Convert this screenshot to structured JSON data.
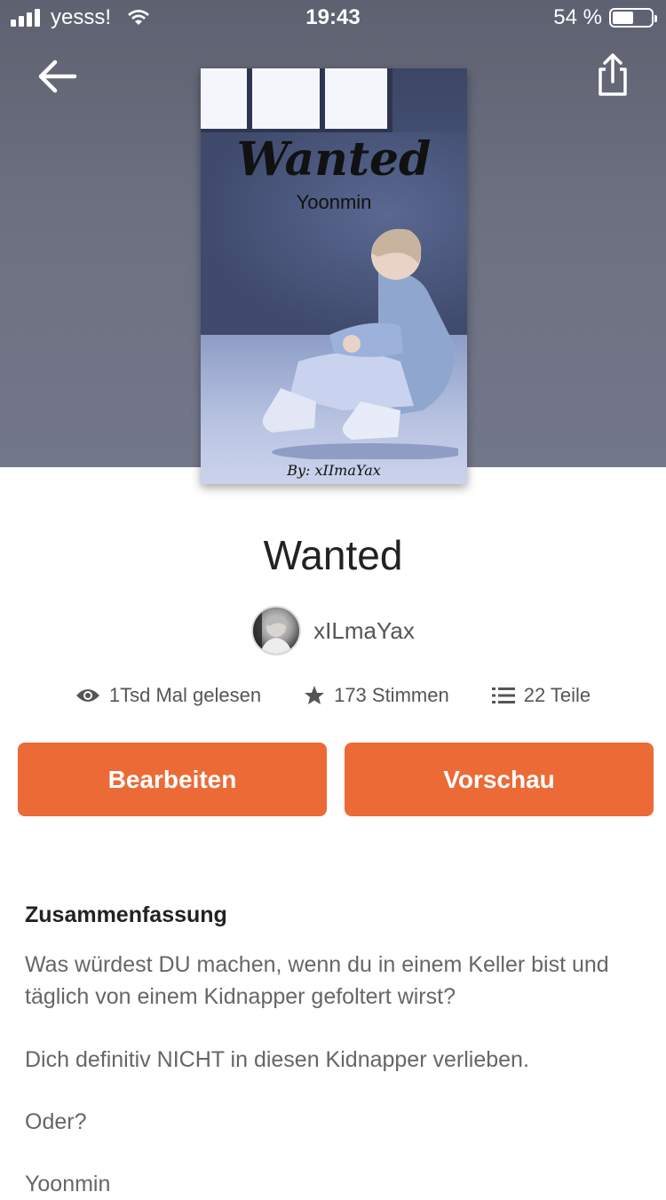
{
  "status_bar": {
    "carrier": "yesss!",
    "time": "19:43",
    "battery_text": "54 %",
    "battery_level": 0.54
  },
  "header": {
    "back_icon": "arrow-left-icon",
    "share_icon": "share-icon"
  },
  "cover": {
    "title": "Wanted",
    "subtitle": "Yoonmin",
    "author_line": "By: xIImaYax"
  },
  "story": {
    "title": "Wanted",
    "author": "xILmaYax"
  },
  "stats": {
    "reads": "1Tsd Mal gelesen",
    "votes": "173 Stimmen",
    "parts": "22 Teile",
    "reads_icon": "eye-icon",
    "votes_icon": "star-icon",
    "parts_icon": "list-icon"
  },
  "actions": {
    "edit_label": "Bearbeiten",
    "preview_label": "Vorschau"
  },
  "summary": {
    "heading": "Zusammenfassung",
    "paragraphs": [
      "Was würdest DU machen, wenn du in einem Keller bist und täglich von einem Kidnapper gefoltert wirst?",
      "Dich definitiv NICHT in diesen Kidnapper verlieben.",
      "Oder?",
      "Yoonmin"
    ]
  },
  "colors": {
    "accent": "#ec6a36",
    "header_bg": "#6c7080"
  }
}
